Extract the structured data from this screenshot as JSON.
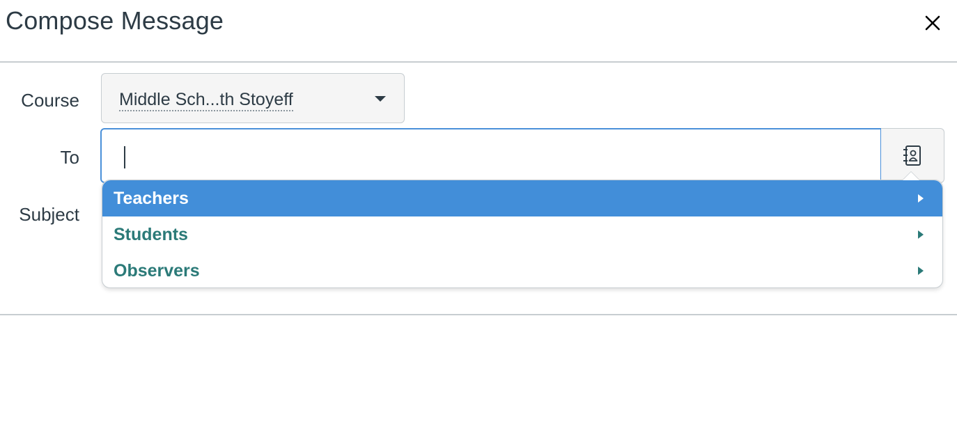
{
  "dialog": {
    "title": "Compose Message",
    "close_icon": "close-icon"
  },
  "form": {
    "course_label": "Course",
    "course_value": "Middle Sch...th Stoyeff",
    "to_label": "To",
    "to_value": "",
    "subject_label": "Subject",
    "address_book_icon": "address-book-icon"
  },
  "recipient_menu": {
    "items": [
      {
        "label": "Teachers",
        "active": true
      },
      {
        "label": "Students",
        "active": false
      },
      {
        "label": "Observers",
        "active": false
      }
    ]
  },
  "colors": {
    "accent": "#428ed9",
    "link": "#2b7a78",
    "text": "#2d3b45",
    "border": "#c7cdd1"
  }
}
